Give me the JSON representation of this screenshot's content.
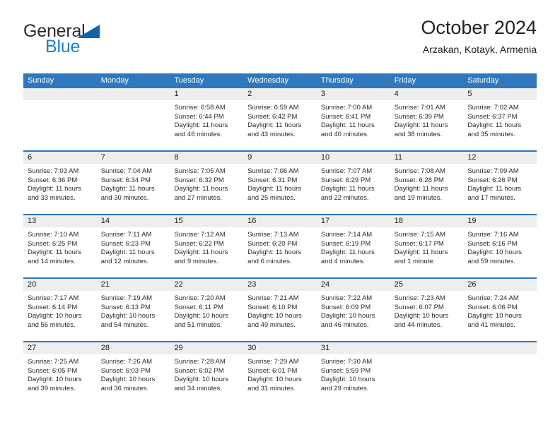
{
  "brand": {
    "name_top": "General",
    "name_bottom": "Blue",
    "colors": {
      "dark": "#2b2b2b",
      "blue": "#1b7fd4",
      "triangle": "#1263ad"
    }
  },
  "header": {
    "month_title": "October 2024",
    "location": "Arzakan, Kotayk, Armenia"
  },
  "calendar": {
    "header_color": "#2f78bd",
    "date_band_color": "#eeeeee",
    "day_names": [
      "Sunday",
      "Monday",
      "Tuesday",
      "Wednesday",
      "Thursday",
      "Friday",
      "Saturday"
    ],
    "weeks": [
      [
        {
          "empty": true
        },
        {
          "empty": true
        },
        {
          "date": "1",
          "sunrise": "Sunrise: 6:58 AM",
          "sunset": "Sunset: 6:44 PM",
          "daylight": "Daylight: 11 hours and 46 minutes."
        },
        {
          "date": "2",
          "sunrise": "Sunrise: 6:59 AM",
          "sunset": "Sunset: 6:42 PM",
          "daylight": "Daylight: 11 hours and 43 minutes."
        },
        {
          "date": "3",
          "sunrise": "Sunrise: 7:00 AM",
          "sunset": "Sunset: 6:41 PM",
          "daylight": "Daylight: 11 hours and 40 minutes."
        },
        {
          "date": "4",
          "sunrise": "Sunrise: 7:01 AM",
          "sunset": "Sunset: 6:39 PM",
          "daylight": "Daylight: 11 hours and 38 minutes."
        },
        {
          "date": "5",
          "sunrise": "Sunrise: 7:02 AM",
          "sunset": "Sunset: 6:37 PM",
          "daylight": "Daylight: 11 hours and 35 minutes."
        }
      ],
      [
        {
          "date": "6",
          "sunrise": "Sunrise: 7:03 AM",
          "sunset": "Sunset: 6:36 PM",
          "daylight": "Daylight: 11 hours and 33 minutes."
        },
        {
          "date": "7",
          "sunrise": "Sunrise: 7:04 AM",
          "sunset": "Sunset: 6:34 PM",
          "daylight": "Daylight: 11 hours and 30 minutes."
        },
        {
          "date": "8",
          "sunrise": "Sunrise: 7:05 AM",
          "sunset": "Sunset: 6:32 PM",
          "daylight": "Daylight: 11 hours and 27 minutes."
        },
        {
          "date": "9",
          "sunrise": "Sunrise: 7:06 AM",
          "sunset": "Sunset: 6:31 PM",
          "daylight": "Daylight: 11 hours and 25 minutes."
        },
        {
          "date": "10",
          "sunrise": "Sunrise: 7:07 AM",
          "sunset": "Sunset: 6:29 PM",
          "daylight": "Daylight: 11 hours and 22 minutes."
        },
        {
          "date": "11",
          "sunrise": "Sunrise: 7:08 AM",
          "sunset": "Sunset: 6:28 PM",
          "daylight": "Daylight: 11 hours and 19 minutes."
        },
        {
          "date": "12",
          "sunrise": "Sunrise: 7:09 AM",
          "sunset": "Sunset: 6:26 PM",
          "daylight": "Daylight: 11 hours and 17 minutes."
        }
      ],
      [
        {
          "date": "13",
          "sunrise": "Sunrise: 7:10 AM",
          "sunset": "Sunset: 6:25 PM",
          "daylight": "Daylight: 11 hours and 14 minutes."
        },
        {
          "date": "14",
          "sunrise": "Sunrise: 7:11 AM",
          "sunset": "Sunset: 6:23 PM",
          "daylight": "Daylight: 11 hours and 12 minutes."
        },
        {
          "date": "15",
          "sunrise": "Sunrise: 7:12 AM",
          "sunset": "Sunset: 6:22 PM",
          "daylight": "Daylight: 11 hours and 9 minutes."
        },
        {
          "date": "16",
          "sunrise": "Sunrise: 7:13 AM",
          "sunset": "Sunset: 6:20 PM",
          "daylight": "Daylight: 11 hours and 6 minutes."
        },
        {
          "date": "17",
          "sunrise": "Sunrise: 7:14 AM",
          "sunset": "Sunset: 6:19 PM",
          "daylight": "Daylight: 11 hours and 4 minutes."
        },
        {
          "date": "18",
          "sunrise": "Sunrise: 7:15 AM",
          "sunset": "Sunset: 6:17 PM",
          "daylight": "Daylight: 11 hours and 1 minute."
        },
        {
          "date": "19",
          "sunrise": "Sunrise: 7:16 AM",
          "sunset": "Sunset: 6:16 PM",
          "daylight": "Daylight: 10 hours and 59 minutes."
        }
      ],
      [
        {
          "date": "20",
          "sunrise": "Sunrise: 7:17 AM",
          "sunset": "Sunset: 6:14 PM",
          "daylight": "Daylight: 10 hours and 56 minutes."
        },
        {
          "date": "21",
          "sunrise": "Sunrise: 7:19 AM",
          "sunset": "Sunset: 6:13 PM",
          "daylight": "Daylight: 10 hours and 54 minutes."
        },
        {
          "date": "22",
          "sunrise": "Sunrise: 7:20 AM",
          "sunset": "Sunset: 6:11 PM",
          "daylight": "Daylight: 10 hours and 51 minutes."
        },
        {
          "date": "23",
          "sunrise": "Sunrise: 7:21 AM",
          "sunset": "Sunset: 6:10 PM",
          "daylight": "Daylight: 10 hours and 49 minutes."
        },
        {
          "date": "24",
          "sunrise": "Sunrise: 7:22 AM",
          "sunset": "Sunset: 6:09 PM",
          "daylight": "Daylight: 10 hours and 46 minutes."
        },
        {
          "date": "25",
          "sunrise": "Sunrise: 7:23 AM",
          "sunset": "Sunset: 6:07 PM",
          "daylight": "Daylight: 10 hours and 44 minutes."
        },
        {
          "date": "26",
          "sunrise": "Sunrise: 7:24 AM",
          "sunset": "Sunset: 6:06 PM",
          "daylight": "Daylight: 10 hours and 41 minutes."
        }
      ],
      [
        {
          "date": "27",
          "sunrise": "Sunrise: 7:25 AM",
          "sunset": "Sunset: 6:05 PM",
          "daylight": "Daylight: 10 hours and 39 minutes."
        },
        {
          "date": "28",
          "sunrise": "Sunrise: 7:26 AM",
          "sunset": "Sunset: 6:03 PM",
          "daylight": "Daylight: 10 hours and 36 minutes."
        },
        {
          "date": "29",
          "sunrise": "Sunrise: 7:28 AM",
          "sunset": "Sunset: 6:02 PM",
          "daylight": "Daylight: 10 hours and 34 minutes."
        },
        {
          "date": "30",
          "sunrise": "Sunrise: 7:29 AM",
          "sunset": "Sunset: 6:01 PM",
          "daylight": "Daylight: 10 hours and 31 minutes."
        },
        {
          "date": "31",
          "sunrise": "Sunrise: 7:30 AM",
          "sunset": "Sunset: 5:59 PM",
          "daylight": "Daylight: 10 hours and 29 minutes."
        },
        {
          "empty": true
        },
        {
          "empty": true
        }
      ]
    ]
  }
}
